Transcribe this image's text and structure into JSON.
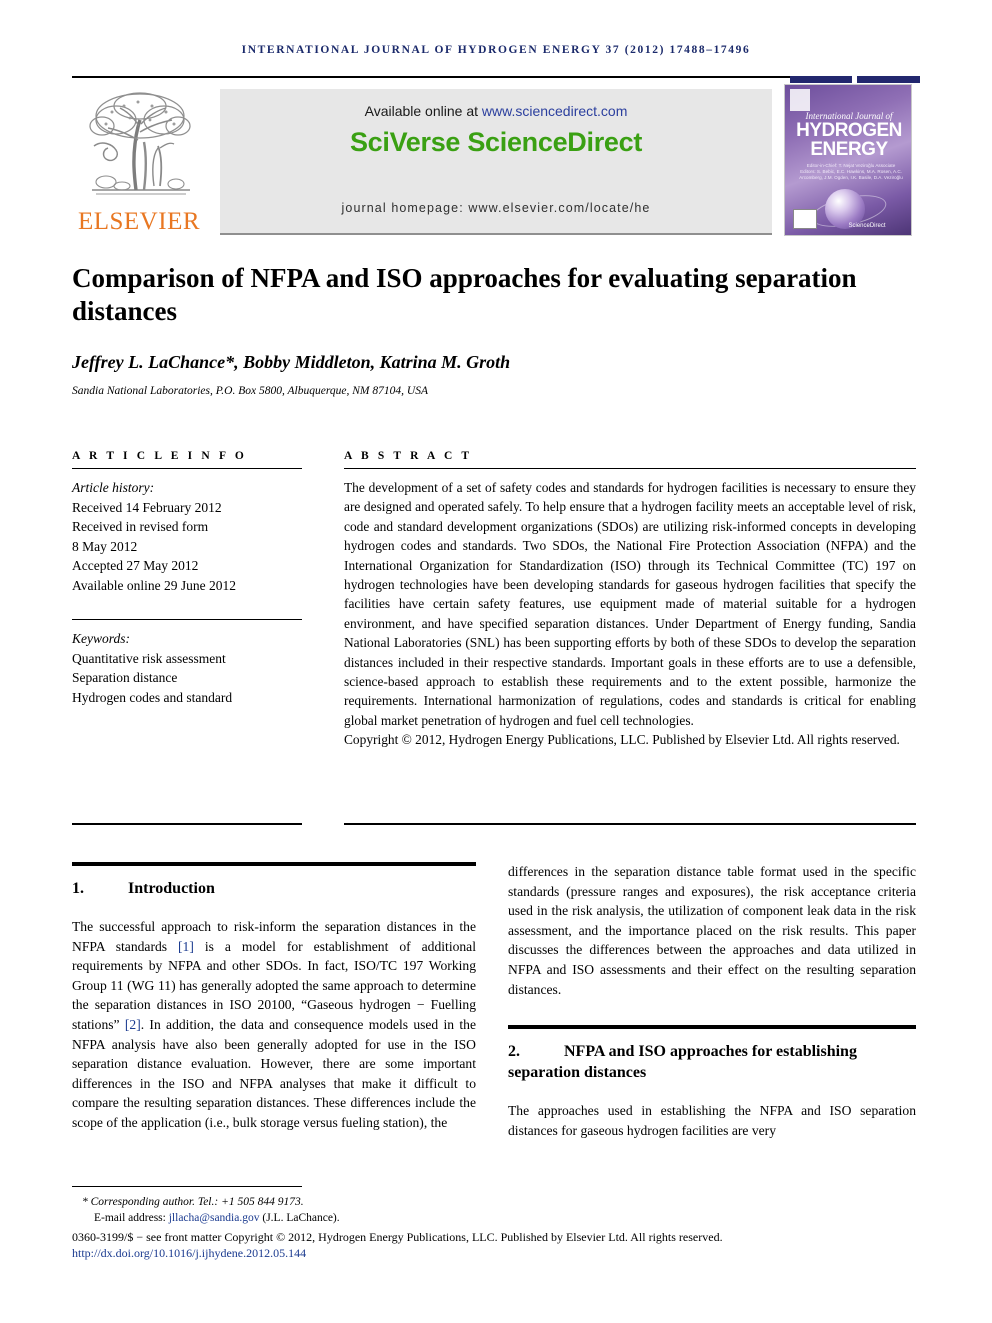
{
  "running_head": "INTERNATIONAL JOURNAL OF HYDROGEN ENERGY 37 (2012) 17488–17496",
  "masthead": {
    "publisher_wordmark": "ELSEVIER",
    "available_prefix": "Available online at ",
    "available_url": "www.sciencedirect.com",
    "brand": "SciVerse ScienceDirect",
    "homepage": "journal homepage: www.elsevier.com/locate/he",
    "cover": {
      "line1": "International Journal of",
      "line2": "HYDROGEN",
      "line3": "ENERGY",
      "editors": "Editor-in-Chief: T. Nejat Veziroğlu  Associate Editors: S. Bebic, E.C. Hawkins, M.A. Rosen, A.C. Arcomberg, J.M. Ogden, I.K. Basile, D.A. Veziroğlu",
      "sciencedirect": "ScienceDirect"
    }
  },
  "article": {
    "title": "Comparison of NFPA and ISO approaches for evaluating separation distances",
    "authors": "Jeffrey L. LaChance*, Bobby Middleton, Katrina M. Groth",
    "affiliation": "Sandia National Laboratories, P.O. Box 5800, Albuquerque, NM 87104, USA"
  },
  "info": {
    "heading": "A R T I C L E   I N F O",
    "history_label": "Article history:",
    "history": [
      "Received 14 February 2012",
      "Received in revised form",
      "8 May 2012",
      "Accepted 27 May 2012",
      "Available online 29 June 2012"
    ],
    "keywords_label": "Keywords:",
    "keywords": [
      "Quantitative risk assessment",
      "Separation distance",
      "Hydrogen codes and standard"
    ]
  },
  "abstract": {
    "heading": "A B S T R A C T",
    "body": "The development of a set of safety codes and standards for hydrogen facilities is necessary to ensure they are designed and operated safely. To help ensure that a hydrogen facility meets an acceptable level of risk, code and standard development organizations (SDOs) are utilizing risk-informed concepts in developing hydrogen codes and standards. Two SDOs, the National Fire Protection Association (NFPA) and the International Organization for Standardization (ISO) through its Technical Committee (TC) 197 on hydrogen technologies have been developing standards for gaseous hydrogen facilities that specify the facilities have certain safety features, use equipment made of material suitable for a hydrogen environment, and have specified separation distances. Under Department of Energy funding, Sandia National Laboratories (SNL) has been supporting efforts by both of these SDOs to develop the separation distances included in their respective standards. Important goals in these efforts are to use a defensible, science-based approach to establish these requirements and to the extent possible, harmonize the requirements. International harmonization of regulations, codes and standards is critical for enabling global market penetration of hydrogen and fuel cell technologies.",
    "copyright": "Copyright © 2012, Hydrogen Energy Publications, LLC. Published by Elsevier Ltd. All rights reserved."
  },
  "sections": {
    "intro": {
      "number": "1.",
      "title": "Introduction",
      "p1_a": "The successful approach to risk-inform the separation distances in the NFPA standards ",
      "p1_cite1": "[1]",
      "p1_b": " is a model for establishment of additional requirements by NFPA and other SDOs. In fact, ISO/TC 197 Working Group 11 (WG 11) has generally adopted the same approach to determine the separation distances in ISO 20100, “Gaseous hydrogen − Fuelling stations” ",
      "p1_cite2": "[2]",
      "p1_c": ". In addition, the data and consequence models used in the NFPA analysis have also been generally adopted for use in the ISO separation distance evaluation. However, there are some important differences in the ISO and NFPA analyses that make it difficult to compare the resulting separation distances. These differences include the scope of the application (i.e., bulk storage versus fueling station), the",
      "p1_cont": "differences in the separation distance table format used in the specific standards (pressure ranges and exposures), the risk acceptance criteria used in the risk analysis, the utilization of component leak data in the risk assessment, and the importance placed on the risk results. This paper discusses the differences between the approaches and data utilized in NFPA and ISO assessments and their effect on the resulting separation distances."
    },
    "approaches": {
      "number": "2.",
      "title": "NFPA and ISO approaches for establishing separation distances",
      "p1": "The approaches used in establishing the NFPA and ISO separation distances for gaseous hydrogen facilities are very"
    }
  },
  "footer": {
    "corresponding": "* Corresponding author. Tel.: +1 505 844 9173.",
    "email_label": "E-mail address: ",
    "email": "jllacha@sandia.gov",
    "email_suffix": " (J.L. LaChance).",
    "issn": "0360-3199/$ − see front matter Copyright © 2012, Hydrogen Energy Publications, LLC. Published by Elsevier Ltd. All rights reserved.",
    "doi": "http://dx.doi.org/10.1016/j.ijhydene.2012.05.144"
  }
}
